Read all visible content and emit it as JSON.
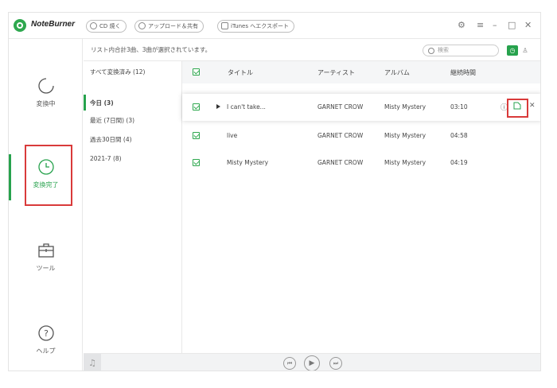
{
  "app": {
    "brand": "NoteBurner"
  },
  "toolbar": {
    "burn_cd": "CD 焼く",
    "upload_share": "アップロード＆共有",
    "itunes_export": "iTunes へエクスポート",
    "settings_icon": "gear-icon",
    "menu_icon": "menu-icon",
    "minimize_icon": "minimize-icon",
    "maximize_icon": "maximize-icon",
    "close_icon": "close-icon"
  },
  "sidebar": {
    "items": [
      {
        "label": "変換中",
        "icon": "converting-icon"
      },
      {
        "label": "変換完了",
        "icon": "clock-icon",
        "active": true
      },
      {
        "label": "ツール",
        "icon": "toolbox-icon"
      },
      {
        "label": "ヘルプ",
        "icon": "help-icon"
      }
    ]
  },
  "info_line": "リスト内合計3曲、3曲が選択されています。",
  "search": {
    "placeholder": "検索"
  },
  "filters": [
    {
      "label": "すべて変換済み (12)"
    },
    {
      "label": "今日 (3)",
      "active": true
    },
    {
      "label": "最近 (7日間) (3)"
    },
    {
      "label": "過去30日間 (4)"
    },
    {
      "label": "2021-7 (8)"
    }
  ],
  "table": {
    "headers": {
      "title": "タイトル",
      "artist": "アーティスト",
      "album": "アルバム",
      "duration": "継続時間"
    },
    "rows": [
      {
        "title": "I can't take...",
        "artist": "GARNET CROW",
        "album": "Misty Mystery",
        "duration": "03:10",
        "selected": true
      },
      {
        "title": "live",
        "artist": "GARNET CROW",
        "album": "Misty Mystery",
        "duration": "04:58"
      },
      {
        "title": "Misty Mystery",
        "artist": "GARNET CROW",
        "album": "Misty Mystery",
        "duration": "04:19"
      }
    ]
  },
  "colors": {
    "accent": "#27a24d",
    "highlight": "#d93a3a"
  }
}
